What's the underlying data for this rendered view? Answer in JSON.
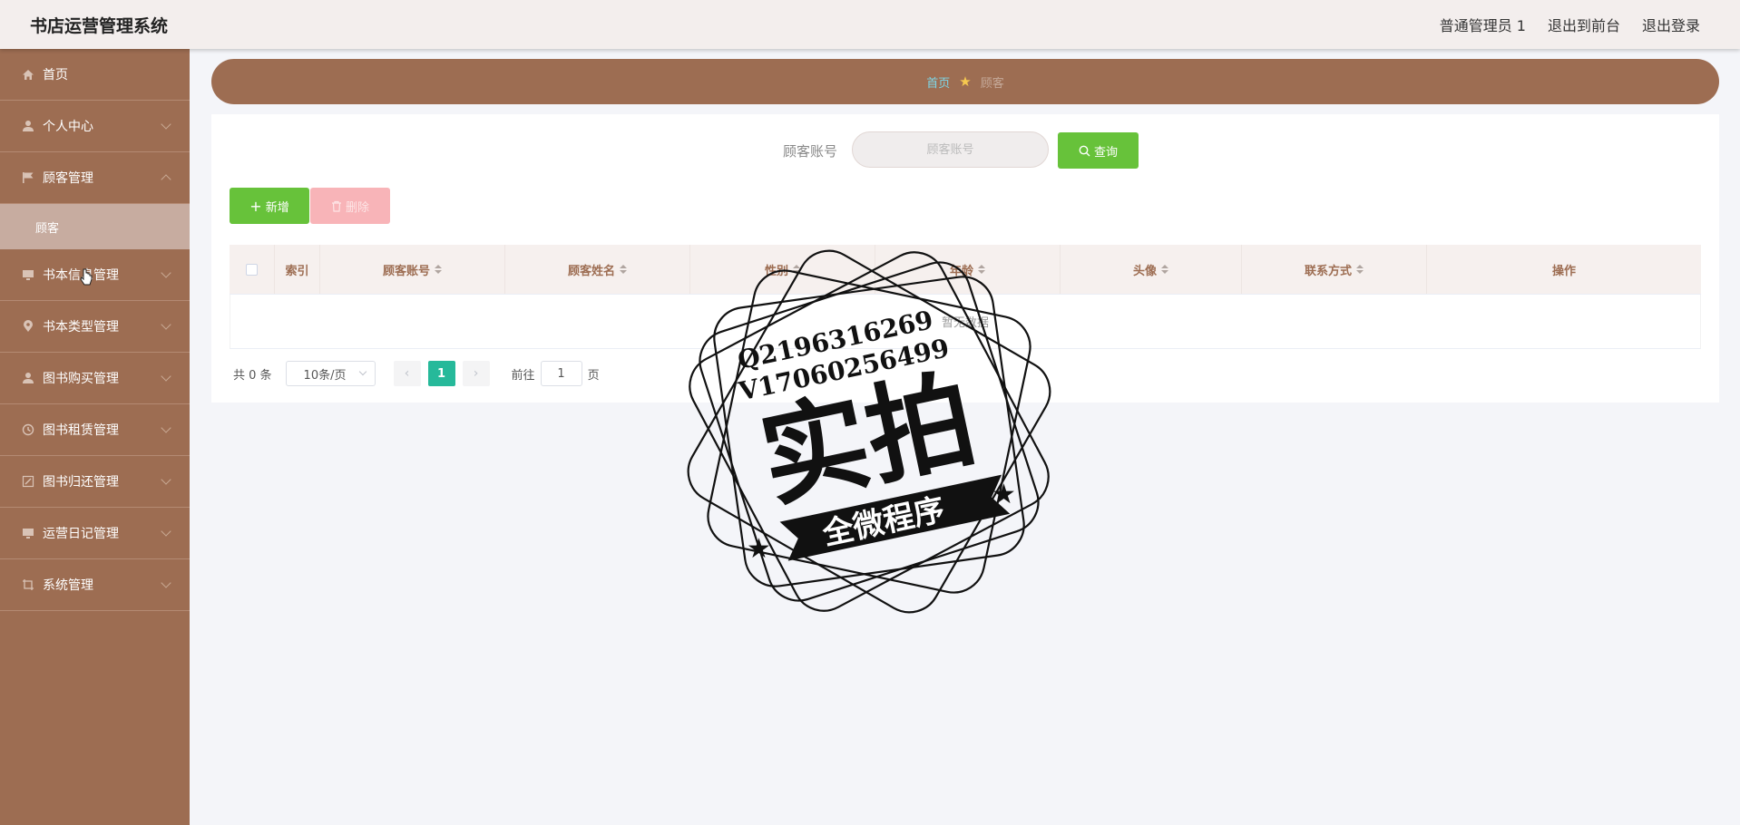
{
  "header": {
    "title": "书店运营管理系统",
    "links": [
      "普通管理员 1",
      "退出到前台",
      "退出登录"
    ]
  },
  "sidebar": {
    "items": [
      {
        "label": "首页",
        "icon": "home-icon"
      },
      {
        "label": "个人中心",
        "icon": "user-icon"
      },
      {
        "label": "顾客管理",
        "icon": "flag-icon",
        "expanded": true,
        "children": [
          "顾客"
        ]
      },
      {
        "label": "书本信息管理",
        "icon": "monitor-icon"
      },
      {
        "label": "书本类型管理",
        "icon": "location-icon"
      },
      {
        "label": "图书购买管理",
        "icon": "user-icon"
      },
      {
        "label": "图书租赁管理",
        "icon": "clock-icon"
      },
      {
        "label": "图书归还管理",
        "icon": "edit-icon"
      },
      {
        "label": "运营日记管理",
        "icon": "monitor-icon"
      },
      {
        "label": "系统管理",
        "icon": "crop-icon"
      }
    ]
  },
  "breadcrumb": {
    "home": "首页",
    "current": "顾客"
  },
  "search": {
    "label": "顾客账号",
    "placeholder": "顾客账号",
    "button": "查询"
  },
  "actions": {
    "add": "新增",
    "delete": "删除"
  },
  "table": {
    "columns": [
      {
        "label": "索引",
        "sortable": false
      },
      {
        "label": "顾客账号",
        "sortable": true
      },
      {
        "label": "顾客姓名",
        "sortable": true
      },
      {
        "label": "性别",
        "sortable": true
      },
      {
        "label": "年龄",
        "sortable": true
      },
      {
        "label": "头像",
        "sortable": true
      },
      {
        "label": "联系方式",
        "sortable": true
      },
      {
        "label": "操作",
        "sortable": false
      }
    ],
    "empty_text": "暂无数据"
  },
  "pagination": {
    "total": "共 0 条",
    "page_size": "10条/页",
    "current_page": "1",
    "goto_label": "前往",
    "goto_value": "1",
    "page_unit": "页"
  },
  "watermark": {
    "line1": "Q2196316269",
    "line2": "V17060256499",
    "big": "实拍",
    "banner": "全微程序"
  },
  "colors": {
    "sidebar": "#9d6d52",
    "header": "#f3eeed",
    "accent_green": "#67c23a",
    "page_active": "#26b99a",
    "delete_disabled": "#f8b4b8"
  }
}
